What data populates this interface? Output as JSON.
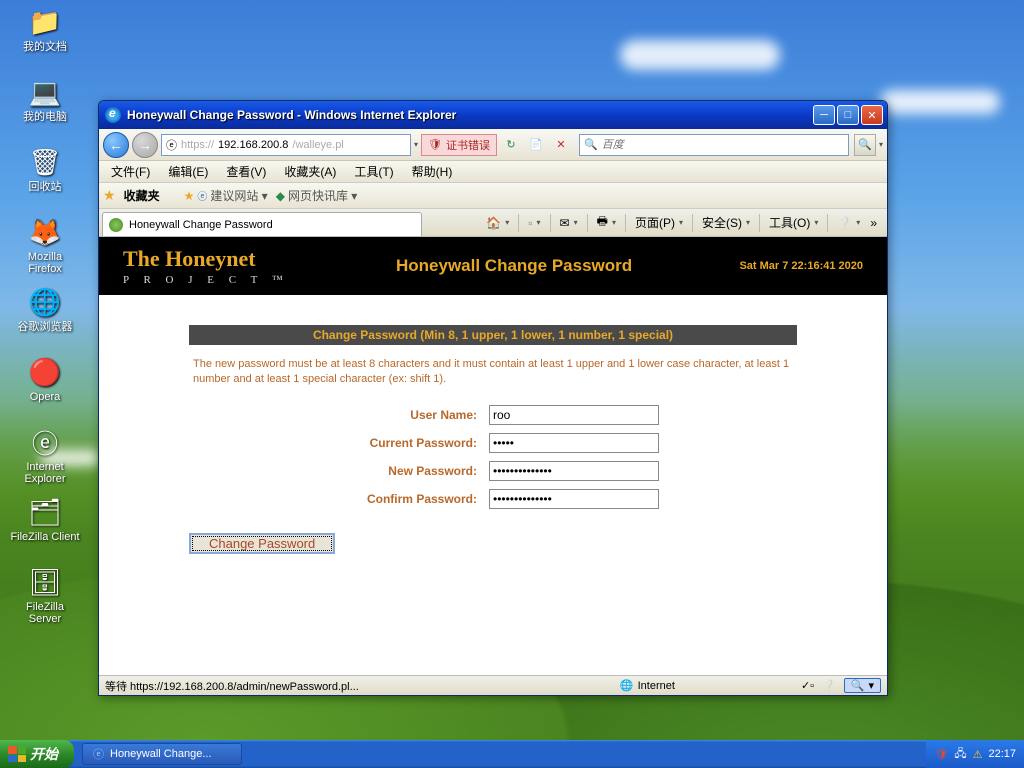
{
  "desktop": {
    "icons": [
      {
        "label": "我的文档",
        "glyph": "📁"
      },
      {
        "label": "我的电脑",
        "glyph": "💻"
      },
      {
        "label": "回收站",
        "glyph": "🗑"
      },
      {
        "label": "Mozilla Firefox",
        "glyph": "🦊"
      },
      {
        "label": "谷歌浏览器",
        "glyph": "🌐"
      },
      {
        "label": "Opera",
        "glyph": "🔴"
      },
      {
        "label": "Internet Explorer",
        "glyph": "ⓔ"
      },
      {
        "label": "FileZilla Client",
        "glyph": "🗂"
      },
      {
        "label": "FileZilla Server",
        "glyph": "🗄"
      }
    ]
  },
  "taskbar": {
    "start": "开始",
    "task": "Honeywall Change...",
    "clock": "22:17"
  },
  "window": {
    "title": "Honeywall Change Password - Windows Internet Explorer",
    "url_prefix": "https://",
    "url_host": "192.168.200.8",
    "url_path": "/walleye.pl",
    "cert_error": "证书错误",
    "search_placeholder": "百度",
    "menus": [
      "文件(F)",
      "编辑(E)",
      "查看(V)",
      "收藏夹(A)",
      "工具(T)",
      "帮助(H)"
    ],
    "fav_label": "收藏夹",
    "fav_links": [
      "建议网站 ▾",
      "网页快讯库 ▾"
    ],
    "tab_title": "Honeywall Change Password",
    "cmdbar": {
      "page": "页面(P)",
      "safety": "安全(S)",
      "tools": "工具(O)"
    },
    "status_left": "等待 https://192.168.200.8/admin/newPassword.pl...",
    "status_zone": "Internet"
  },
  "page": {
    "logo_main": "The Honeynet",
    "logo_sub": "P R O J E C T ™",
    "title": "Honeywall Change Password",
    "date": "Sat Mar 7 22:16:41 2020",
    "form_title": "Change Password (Min 8, 1 upper, 1 lower, 1 number, 1 special)",
    "form_desc": "The new password must be at least 8 characters and it must contain at least 1 upper and 1 lower case character, at least 1 number and at least 1 special character (ex: shift 1).",
    "labels": {
      "username": "User Name:",
      "current": "Current Password:",
      "newpw": "New Password:",
      "confirm": "Confirm Password:"
    },
    "values": {
      "username": "roo",
      "current": "•••••",
      "newpw": "••••••••••••••",
      "confirm": "••••••••••••••"
    },
    "submit": "Change Password"
  }
}
